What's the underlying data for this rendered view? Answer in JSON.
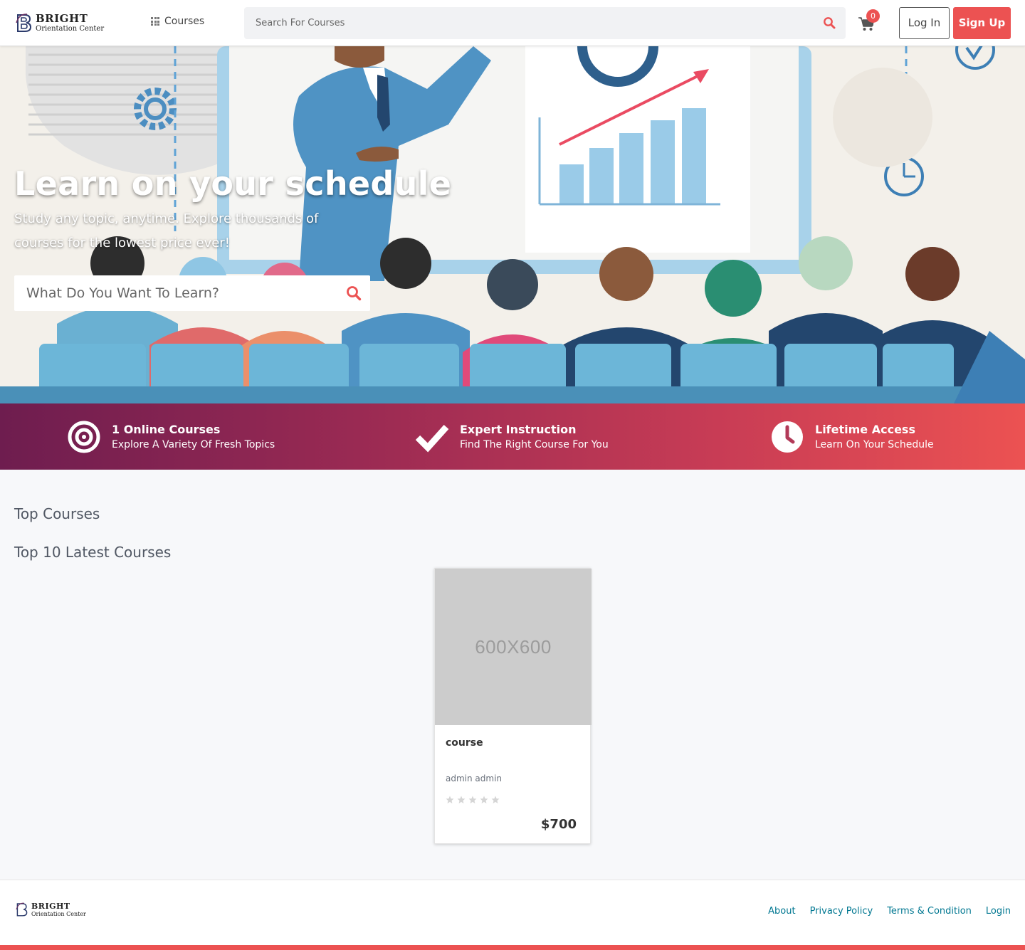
{
  "header": {
    "logo_line1": "BRIGHT",
    "logo_line2": "Orientation Center",
    "courses_label": "Courses",
    "search_placeholder": "Search For Courses",
    "cart_count": "0",
    "login_label": "Log In",
    "signup_label": "Sign Up"
  },
  "hero": {
    "title": "Learn on your schedule",
    "subtitle": "Study any topic, anytime. Explore thousands of courses for the lowest price ever!",
    "search_placeholder": "What Do You Want To Learn?"
  },
  "features": [
    {
      "icon": "target-icon",
      "title": "1 Online Courses",
      "desc": "Explore A Variety Of Fresh Topics"
    },
    {
      "icon": "check-icon",
      "title": "Expert Instruction",
      "desc": "Find The Right Course For You"
    },
    {
      "icon": "clock-icon",
      "title": "Lifetime Access",
      "desc": "Learn On Your Schedule"
    }
  ],
  "sections": {
    "top_courses": "Top Courses",
    "latest_courses": "Top 10 Latest Courses"
  },
  "courses": [
    {
      "thumb_text": "600X600",
      "title": "course",
      "author": "admin admin",
      "rating": 0,
      "rating_max": 5,
      "price": "$700"
    }
  ],
  "footer": {
    "logo_line1": "BRIGHT",
    "logo_line2": "Orientation Center",
    "links": [
      "About",
      "Privacy Policy",
      "Terms & Condition",
      "Login"
    ]
  },
  "colors": {
    "accent": "#ec5252",
    "gradient_start": "#6e1d4f",
    "gradient_end": "#ec5252",
    "link": "#007791"
  }
}
